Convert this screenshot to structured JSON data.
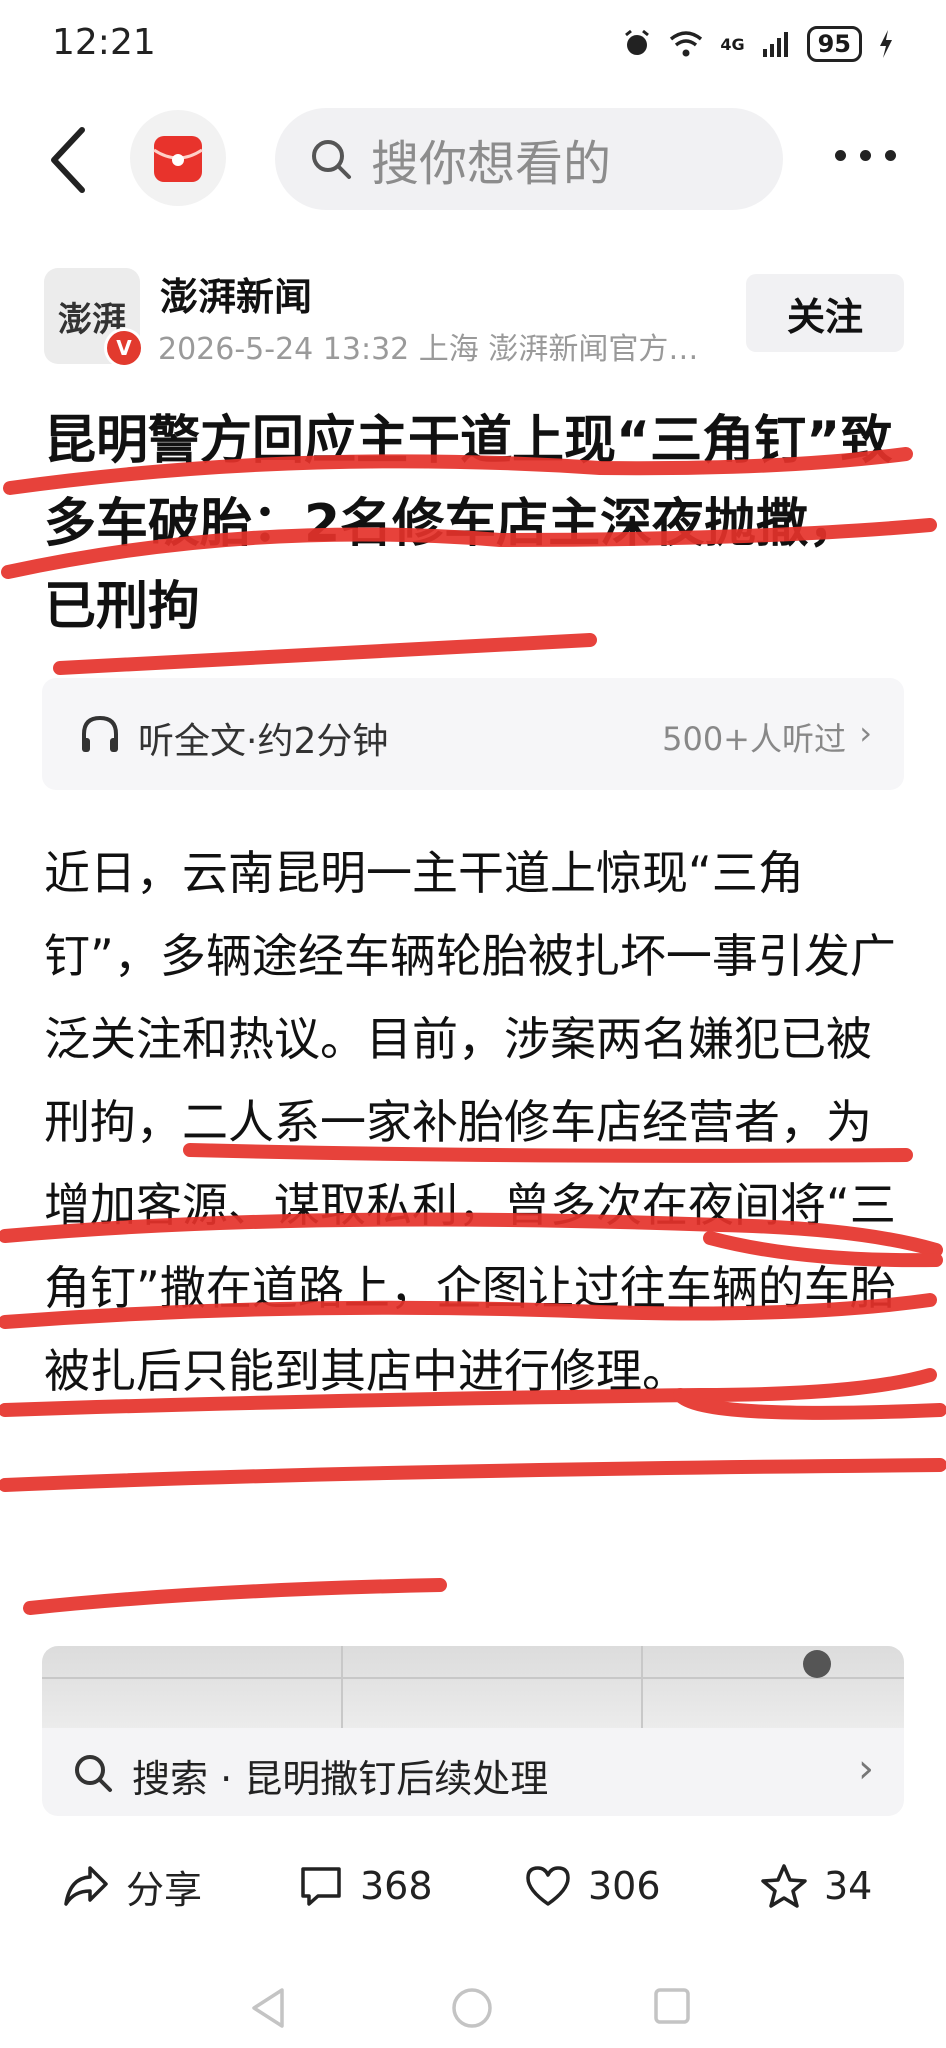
{
  "status_bar": {
    "time": "12:21",
    "network": "4G",
    "battery": "95"
  },
  "top_bar": {
    "search_placeholder": "搜你想看的"
  },
  "author": {
    "name": "澎湃新闻",
    "avatar_text": "澎湃",
    "badge": "V",
    "meta": "2026-5-24  13:32  上海  澎湃新闻官方…",
    "follow_label": "关注"
  },
  "article": {
    "headline": "昆明警方回应主干道上现“三角钉”致多车破胎：2名修车店主深夜抛撒，已刑拘",
    "listen_label": "听全文·约2分钟",
    "listen_count": "500+人听过",
    "body": "近日，云南昆明一主干道上惊现“三角钉”，多辆途经车辆轮胎被扎坏一事引发广泛关注和热议。目前，涉案两名嫌犯已被刑拘，二人系一家补胎修车店经营者，为增加客源、谋取私利，曾多次在夜间将“三角钉”撒在道路上，企图让过往车辆的车胎被扎后只能到其店中进行修理。",
    "related_search": "搜索 · 昆明撒钉后续处理"
  },
  "actions": {
    "share_label": "分享",
    "comments": "368",
    "likes": "306",
    "favorites": "34"
  },
  "colors": {
    "annotation_red": "#e5322b",
    "logo_red": "#e8332c"
  }
}
